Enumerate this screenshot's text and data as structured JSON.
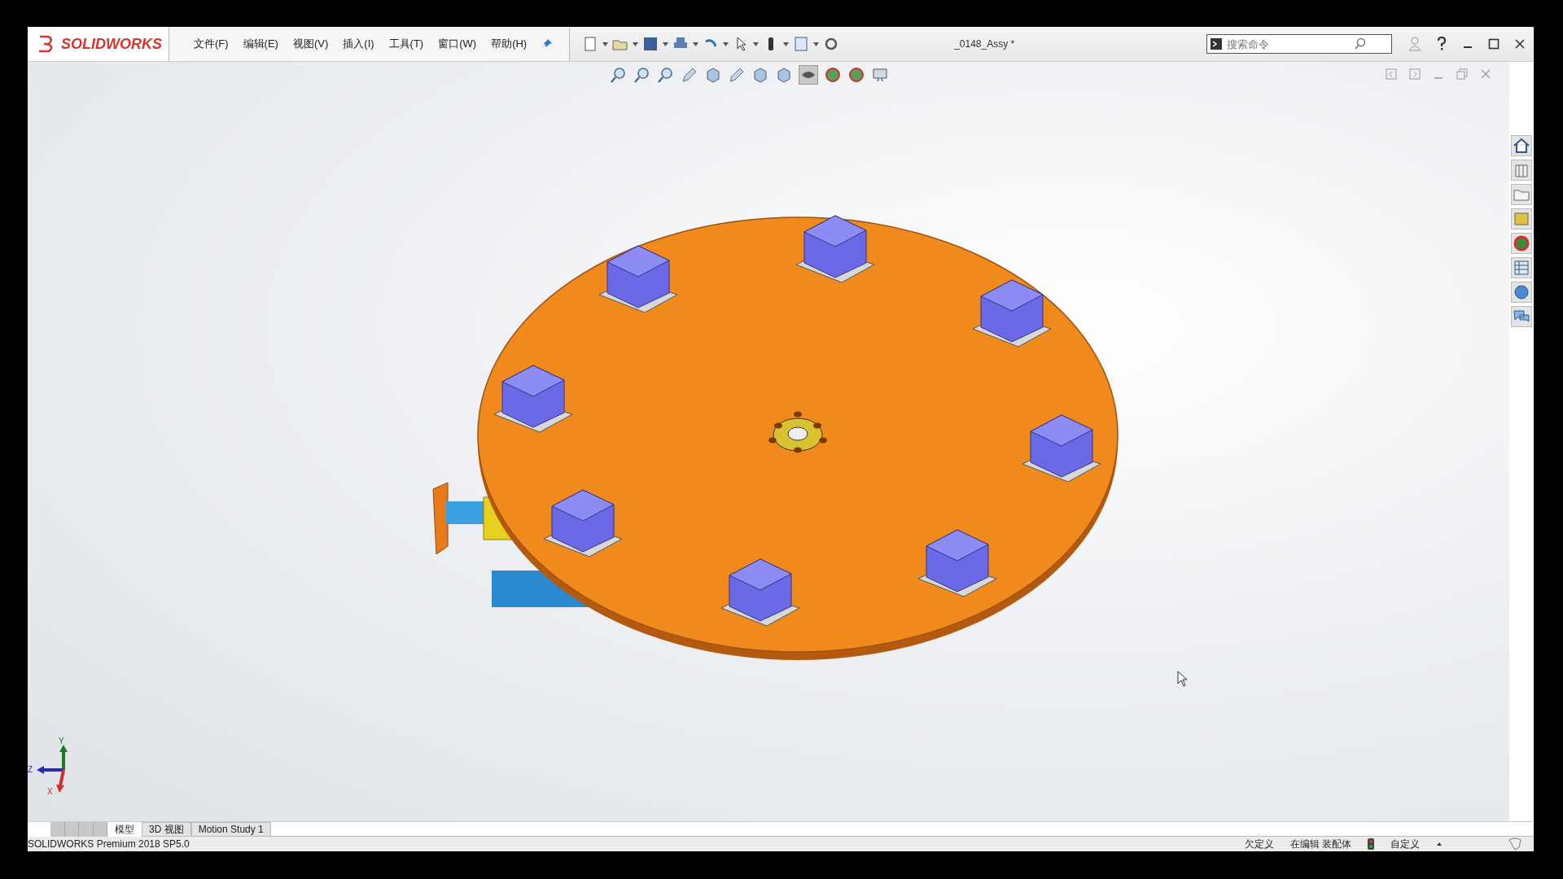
{
  "app": {
    "logo": "SOLIDWORKS",
    "document_title": "_0148_Assy *"
  },
  "menu": [
    "文件(F)",
    "编辑(E)",
    "视图(V)",
    "插入(I)",
    "工具(T)",
    "窗口(W)",
    "帮助(H)"
  ],
  "search": {
    "placeholder": "搜索命令"
  },
  "axes": {
    "y": "Y",
    "z": "Z",
    "x": "X"
  },
  "tabs": [
    {
      "label": "模型",
      "selected": true
    },
    {
      "label": "3D 视图",
      "selected": false
    },
    {
      "label": "Motion Study 1",
      "selected": false
    }
  ],
  "status_bar": {
    "product": "SOLIDWORKS Premium 2018 SP5.0",
    "items": [
      "欠定义",
      "在编辑 装配体",
      "自定义"
    ]
  }
}
